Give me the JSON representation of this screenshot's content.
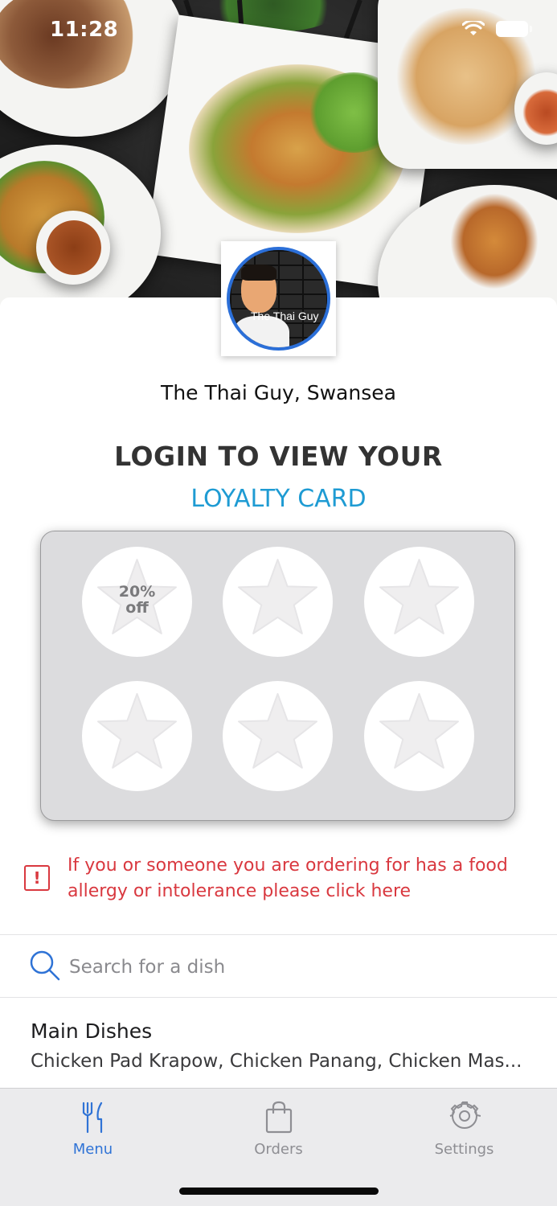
{
  "status_bar": {
    "time": "11:28"
  },
  "venue": {
    "name": "The Thai Guy, Swansea",
    "logo_caption": "The Thai Guy"
  },
  "loyalty": {
    "title": "LOGIN TO VIEW YOUR",
    "link_label": "LOYALTY CARD",
    "reward_label": "20% off",
    "stamps_total": 6
  },
  "allergy": {
    "message": "If you or someone you are ordering for has a food allergy or intolerance please click here",
    "icon": "exclamation-icon"
  },
  "search": {
    "placeholder": "Search for a dish",
    "value": ""
  },
  "categories": [
    {
      "title": "Main Dishes",
      "items": "Chicken Pad Krapow, Chicken Panang, Chicken Mas..."
    }
  ],
  "tabs": [
    {
      "label": "Menu",
      "icon": "fork-knife-icon",
      "active": true
    },
    {
      "label": "Orders",
      "icon": "shopping-bag-icon",
      "active": false
    },
    {
      "label": "Settings",
      "icon": "gear-icon",
      "active": false
    }
  ],
  "colors": {
    "accent_blue": "#2f73d6",
    "loyalty_link": "#1e9bd3",
    "allergy_red": "#d9383f",
    "card_bg": "#dcdcde"
  }
}
